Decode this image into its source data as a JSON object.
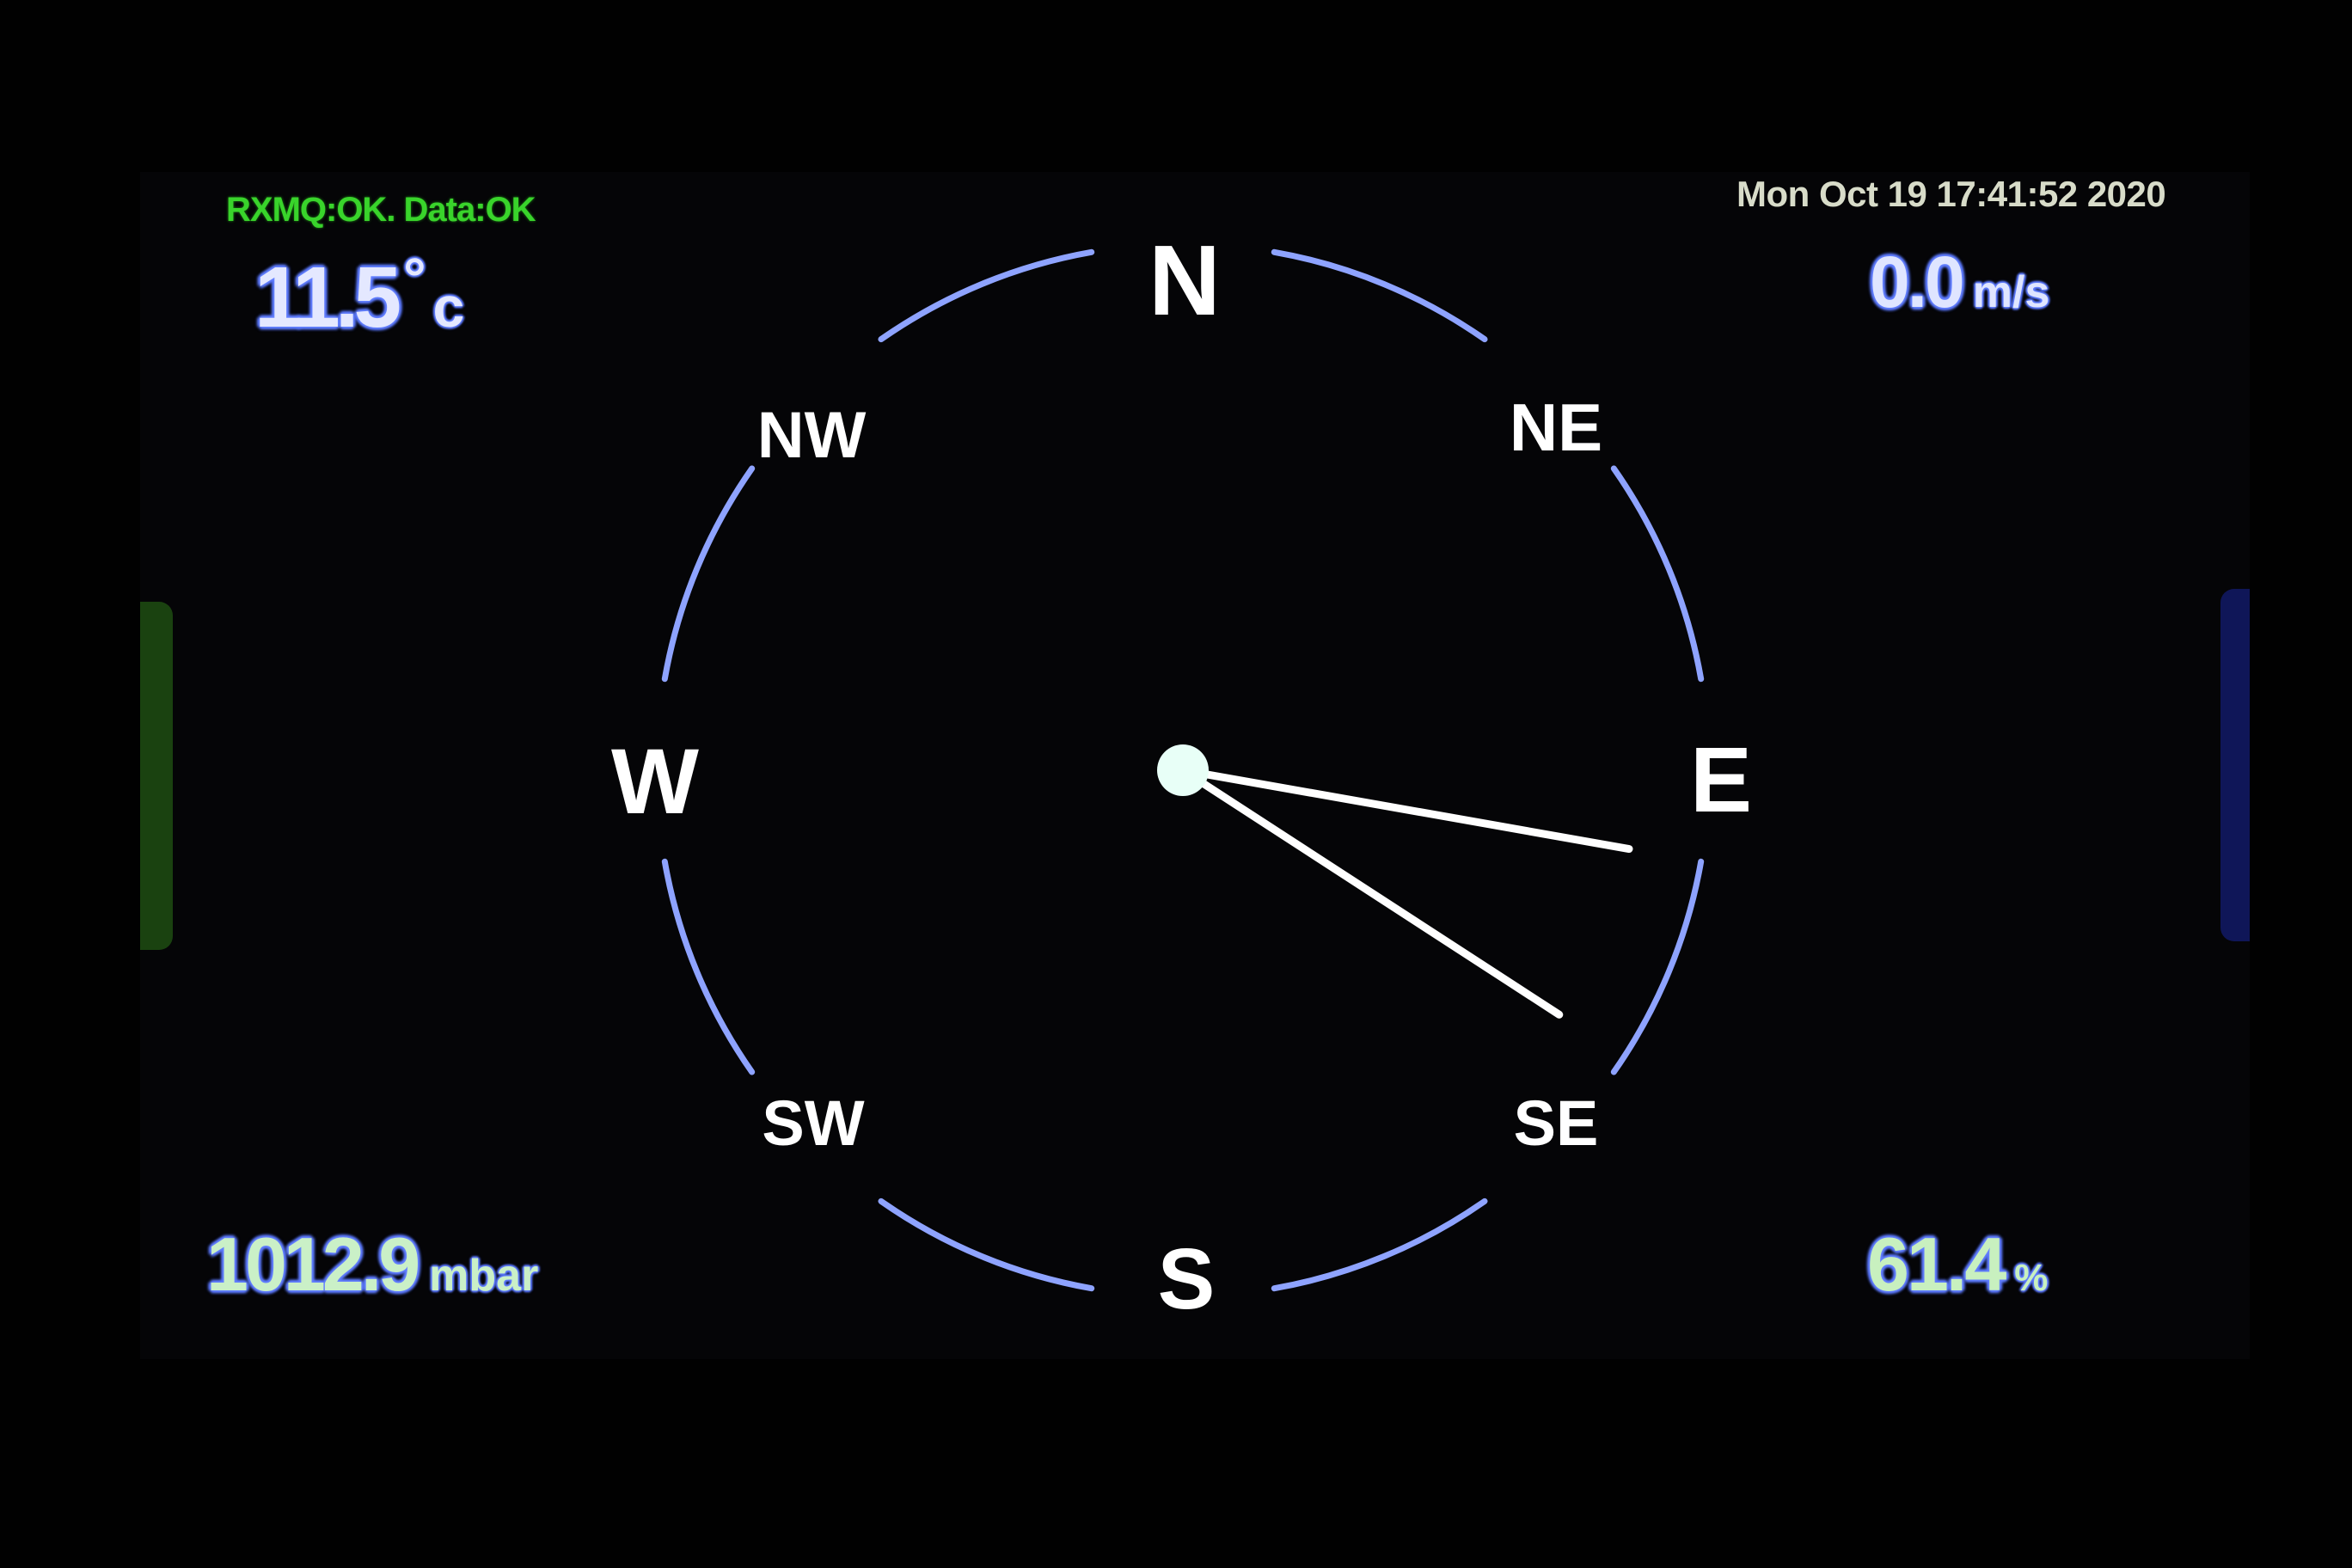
{
  "status": {
    "text": "RXMQ:OK. Data:OK"
  },
  "datetime": {
    "text": "Mon Oct 19 17:41:52 2020"
  },
  "temperature": {
    "value": "11.5",
    "degree_symbol": "°",
    "unit": "c"
  },
  "wind_speed": {
    "value": "0.0",
    "unit": "m/s"
  },
  "pressure": {
    "value": "1012.9",
    "unit": "mbar"
  },
  "humidity": {
    "value": "61.4",
    "unit": "%"
  },
  "compass": {
    "labels": {
      "n": "N",
      "ne": "NE",
      "e": "E",
      "se": "SE",
      "s": "S",
      "sw": "SW",
      "w": "W",
      "nw": "NW"
    },
    "needle_bearings_deg": [
      100,
      123
    ],
    "ring_color": "#8ea3ff",
    "label_color": "#ffffff",
    "needle_color": "#ffffff",
    "hub_color": "#e8fff7"
  },
  "colors": {
    "status_green": "#39d42b",
    "glow_blue": "#5b78ff",
    "left_bar": "#1e4d12",
    "right_bar": "#121a66"
  }
}
